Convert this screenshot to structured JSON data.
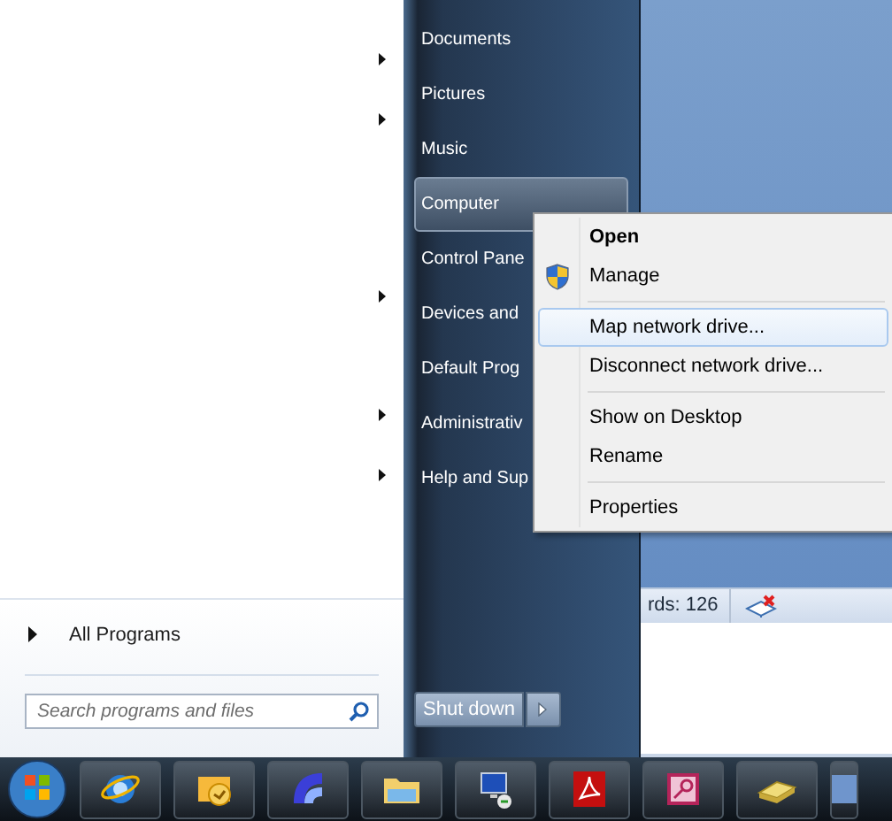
{
  "start_menu": {
    "program_rows": [
      {
        "submenu": true
      },
      {
        "submenu": true
      },
      {
        "submenu": false
      },
      {
        "submenu": false
      },
      {
        "submenu": true
      },
      {
        "submenu": false
      },
      {
        "submenu": true
      },
      {
        "submenu": true
      }
    ],
    "all_programs": "All Programs",
    "search": {
      "placeholder": "Search programs and files"
    },
    "places": [
      {
        "label": "Documents",
        "selected": false
      },
      {
        "label": "Pictures",
        "selected": false
      },
      {
        "label": "Music",
        "selected": false
      },
      {
        "label": "Computer",
        "selected": true
      },
      {
        "label": "Control Pane",
        "selected": false
      },
      {
        "label": "Devices and",
        "selected": false
      },
      {
        "label": "Default Prog",
        "selected": false
      },
      {
        "label": "Administrativ",
        "selected": false
      },
      {
        "label": "Help and Sup",
        "selected": false
      }
    ],
    "shut_down": "Shut down"
  },
  "context_menu": [
    {
      "kind": "item",
      "label": "Open",
      "bold": true,
      "shield": false,
      "selected": false
    },
    {
      "kind": "item",
      "label": "Manage",
      "bold": false,
      "shield": true,
      "selected": false
    },
    {
      "kind": "separator"
    },
    {
      "kind": "item",
      "label": "Map network drive...",
      "bold": false,
      "shield": false,
      "selected": true
    },
    {
      "kind": "item",
      "label": "Disconnect network drive...",
      "bold": false,
      "shield": false,
      "selected": false
    },
    {
      "kind": "separator"
    },
    {
      "kind": "item",
      "label": "Show on Desktop",
      "bold": false,
      "shield": false,
      "selected": false
    },
    {
      "kind": "item",
      "label": "Rename",
      "bold": false,
      "shield": false,
      "selected": false
    },
    {
      "kind": "separator"
    },
    {
      "kind": "item",
      "label": "Properties",
      "bold": false,
      "shield": false,
      "selected": false
    }
  ],
  "background_window": {
    "status_text": "rds: 126"
  },
  "taskbar": {
    "apps": [
      {
        "kind": "browser"
      },
      {
        "kind": "mail"
      },
      {
        "kind": "media"
      },
      {
        "kind": "folder"
      },
      {
        "kind": "remote"
      },
      {
        "kind": "pdf"
      },
      {
        "kind": "database"
      },
      {
        "kind": "drive"
      },
      {
        "kind": "window"
      }
    ]
  }
}
